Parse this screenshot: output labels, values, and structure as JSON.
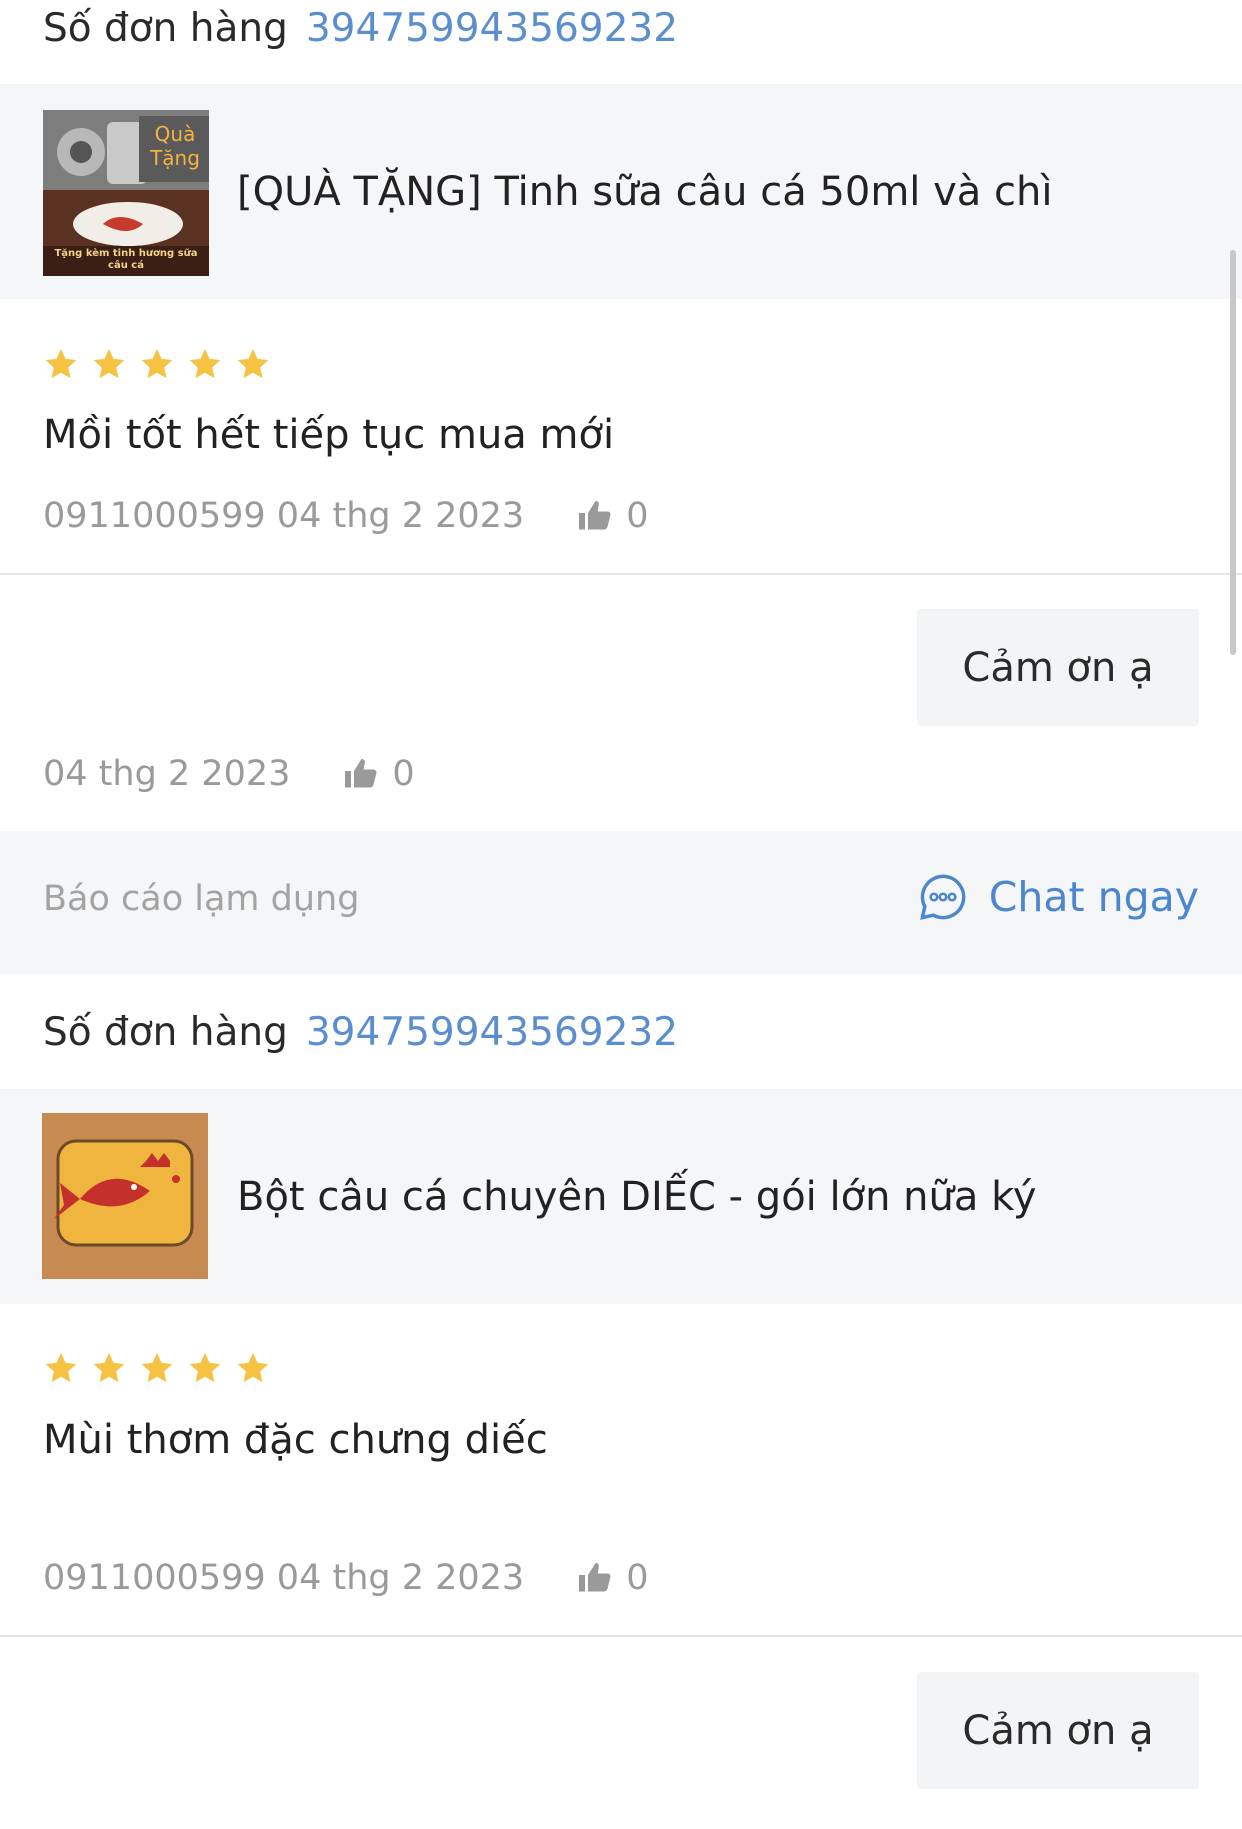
{
  "reviews": [
    {
      "order_label": "Số đơn hàng",
      "order_number": "394759943569232",
      "product": {
        "title": "[QUÀ TẶNG] Tinh sữa câu cá 50ml và chì",
        "thumb_text_top": "Quà Tặng",
        "thumb_text_bottom": "Tặng kèm tinh hương sữa câu cá"
      },
      "rating": 5,
      "text": "Mồi tốt hết tiếp tục mua mới",
      "meta": "0911000599 04 thg 2 2023",
      "likes": "0",
      "reply": {
        "text": "Cảm ơn ạ",
        "date": "04 thg 2 2023",
        "likes": "0"
      },
      "actions": {
        "report": "Báo cáo lạm dụng",
        "chat": "Chat ngay"
      }
    },
    {
      "order_label": "Số đơn hàng",
      "order_number": "394759943569232",
      "product": {
        "title": "Bột câu cá chuyên DIẾC - gói lớn nữa ký"
      },
      "rating": 5,
      "text": "Mùi thơm đặc chưng diếc",
      "meta": "0911000599 04 thg 2 2023",
      "likes": "0",
      "reply": {
        "text": "Cảm ơn ạ"
      }
    }
  ],
  "colors": {
    "accent": "#4b86cf",
    "order_number": "#5b8ecf",
    "star": "#f5c244",
    "muted": "#9a9a9a",
    "panel_bg": "#f5f6f8"
  },
  "icons": {
    "like": "thumbs-up-icon",
    "chat": "chat-bubble-icon",
    "star": "star-icon"
  }
}
